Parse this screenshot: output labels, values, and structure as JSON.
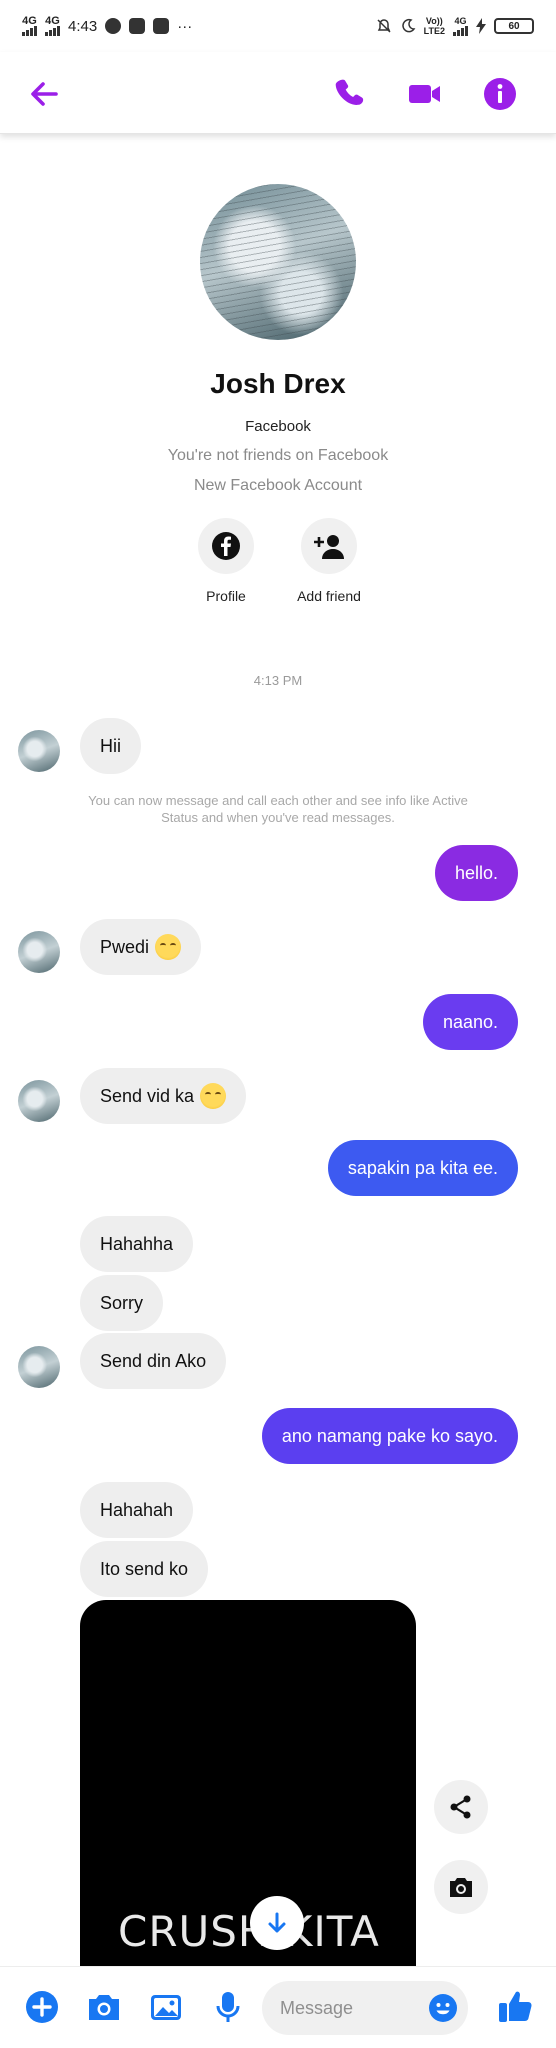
{
  "status_bar": {
    "network_1": "4G",
    "network_2": "4G",
    "time": "4:43",
    "more": "···",
    "volte": "Vo))",
    "lte": "LTE2",
    "network_3": "4G",
    "battery": "60"
  },
  "header": {
    "back_icon": "back-arrow-icon",
    "actions": [
      "phone-icon",
      "video-camera-icon",
      "info-icon"
    ],
    "accent_color": "#9b1fe8"
  },
  "profile": {
    "name": "Josh Drex",
    "platform": "Facebook",
    "friend_status": "You're not friends on Facebook",
    "account_note": "New Facebook Account",
    "profile_label": "Profile",
    "add_friend_label": "Add friend"
  },
  "conversation": {
    "timestamp": "4:13 PM",
    "system_note": "You can now message and call each other and see info like Active Status and when you've read messages.",
    "messages": [
      {
        "from": "them",
        "text": "Hii"
      },
      {
        "from": "me",
        "text": "hello."
      },
      {
        "from": "them",
        "text": "Pwedi",
        "emoji": "hand-over-mouth-emoji"
      },
      {
        "from": "me",
        "text": "naano."
      },
      {
        "from": "them",
        "text": "Send vid ka",
        "emoji": "hand-over-mouth-emoji"
      },
      {
        "from": "me",
        "text": "sapakin pa kita ee."
      },
      {
        "from": "them",
        "text": "Hahahha"
      },
      {
        "from": "them",
        "text": "Sorry"
      },
      {
        "from": "them",
        "text": "Send din Ako"
      },
      {
        "from": "me",
        "text": "ano namang pake ko sayo."
      },
      {
        "from": "them",
        "text": "Hahahah"
      },
      {
        "from": "them",
        "text": "Ito send ko"
      }
    ],
    "video_overlay_text": "CRUSH KITA",
    "side_actions": [
      "share-icon",
      "camera-icon"
    ],
    "scroll_down_icon": "arrow-down-icon"
  },
  "composer": {
    "icons": [
      "plus-icon",
      "camera-icon",
      "photo-icon",
      "microphone-icon"
    ],
    "placeholder": "Message",
    "emoji_icon": "smiley-icon",
    "like_icon": "thumbs-up-icon",
    "accent_color": "#1877f2"
  },
  "colors": {
    "outgoing_1": "#8a2be2",
    "outgoing_2": "#6a3cf0",
    "outgoing_3": "#3d5af1",
    "outgoing_4": "#5b3ff0",
    "incoming": "#eeeeee"
  }
}
